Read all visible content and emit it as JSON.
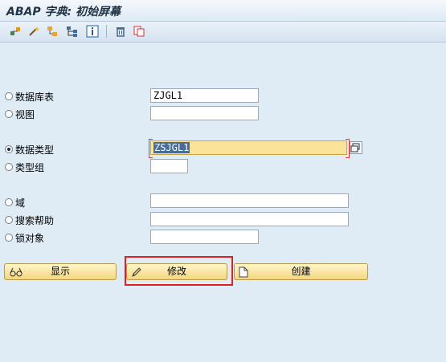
{
  "window": {
    "title": "ABAP 字典: 初始屏幕"
  },
  "toolbar": {
    "icons": [
      "where-used-icon",
      "magic-wand-icon",
      "object-list-icon",
      "hierarchy-icon",
      "info-icon",
      "delete-icon",
      "copy-icon"
    ]
  },
  "form": {
    "options": [
      {
        "label": "数据库表",
        "value": "ZJGL1",
        "checked": false
      },
      {
        "label": "视图",
        "value": "",
        "checked": false
      },
      {
        "label": "数据类型",
        "value": "ZSJGL1",
        "checked": true
      },
      {
        "label": "类型组",
        "value": "",
        "checked": false
      },
      {
        "label": "域",
        "value": "",
        "checked": false
      },
      {
        "label": "搜索帮助",
        "value": "",
        "checked": false
      },
      {
        "label": "锁对象",
        "value": "",
        "checked": false
      }
    ]
  },
  "buttons": {
    "display": "显示",
    "change": "修改",
    "create": "创建"
  },
  "colors": {
    "background": "#dfebf5",
    "active_field": "#fbe39a",
    "button": "#f4d77c",
    "highlight": "#e02020"
  }
}
